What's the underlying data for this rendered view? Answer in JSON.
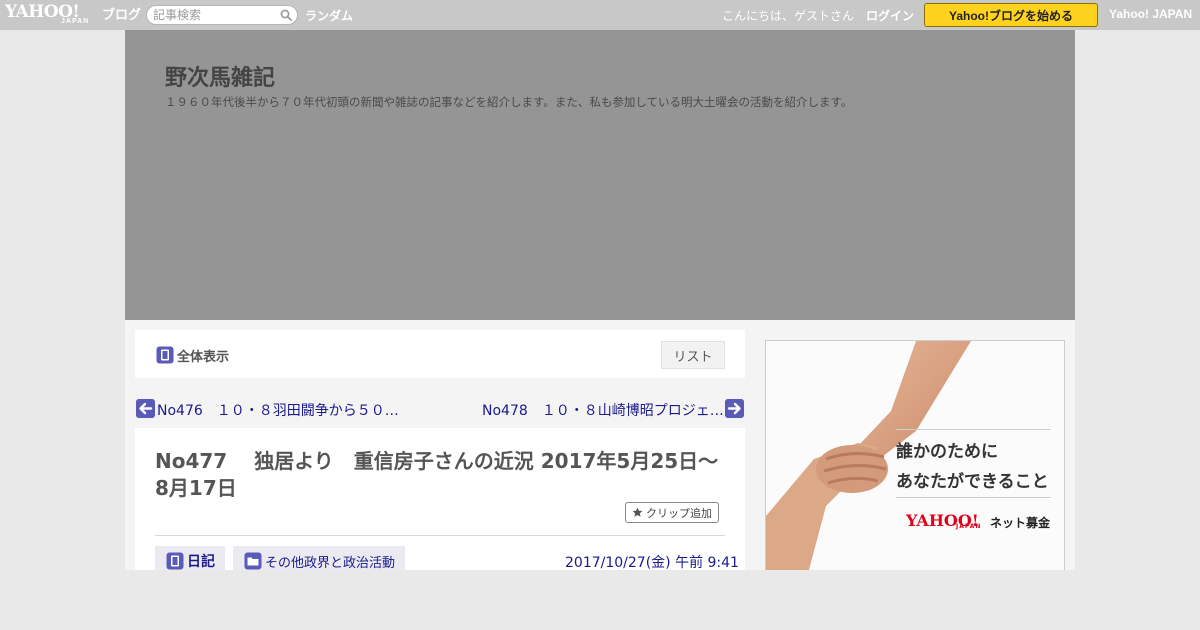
{
  "topbar": {
    "logo": "YAHOO!",
    "logo_sub": "JAPAN",
    "blog_label": "ブログ",
    "search_placeholder": "記事検索",
    "random_label": "ランダム",
    "greeting": "こんにちは、ゲストさん",
    "login_label": "ログイン",
    "start_blog_label": "Yahoo!ブログを始める",
    "yahoo_japan_label": "Yahoo! JAPAN",
    "start_button_color": "#ffd21e"
  },
  "blog": {
    "title": "野次馬雑記",
    "description": "１９６０年代後半から７０年代初頭の新聞や雑誌の記事などを紹介します。また、私も参加している明大土曜会の活動を紹介します。"
  },
  "view_bar": {
    "view_all_label": "全体表示",
    "list_label": "リスト"
  },
  "navigation": {
    "prev_label": "No476　１０・８羽田闘争から５０…",
    "next_label": "No478　１０・８山崎博昭プロジェ…"
  },
  "article": {
    "title": "No477　 独居より　重信房子さんの近況  2017年5月25日～8月17日",
    "clip_label": "クリップ追加",
    "tag_diary": "日記",
    "tag_category": "その他政界と政治活動",
    "date": "2017/10/27(金) 午前 9:41"
  },
  "ad": {
    "line1": "誰かのために",
    "line2": "あなたができること",
    "logo": "YAHOO!",
    "logo_sub": "JAPAN",
    "service": "ネット募金"
  },
  "colors": {
    "link": "#1a1a8c",
    "header_bg": "#959595",
    "icon_accent": "#5a5ab8"
  }
}
